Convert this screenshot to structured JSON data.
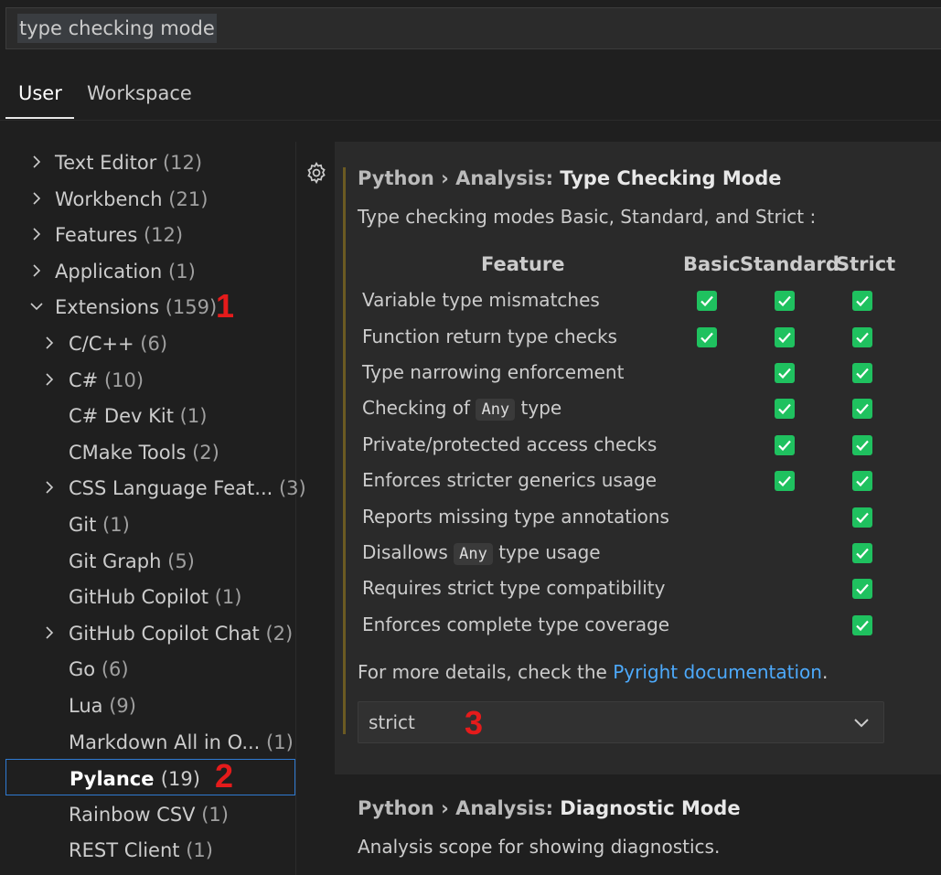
{
  "search": {
    "query": "type checking mode"
  },
  "tabs": [
    {
      "label": "User"
    },
    {
      "label": "Workspace"
    }
  ],
  "tree": [
    {
      "label": "Text Editor",
      "count": "(12)"
    },
    {
      "label": "Workbench",
      "count": "(21)"
    },
    {
      "label": "Features",
      "count": "(12)"
    },
    {
      "label": "Application",
      "count": "(1)"
    },
    {
      "label": "Extensions",
      "count": "(159)"
    },
    {
      "label": "C/C++",
      "count": "(6)"
    },
    {
      "label": "C#",
      "count": "(10)"
    },
    {
      "label": "C# Dev Kit",
      "count": "(1)"
    },
    {
      "label": "CMake Tools",
      "count": "(2)"
    },
    {
      "label": "CSS Language Feat...",
      "count": "(3)"
    },
    {
      "label": "Git",
      "count": "(1)"
    },
    {
      "label": "Git Graph",
      "count": "(5)"
    },
    {
      "label": "GitHub Copilot",
      "count": "(1)"
    },
    {
      "label": "GitHub Copilot Chat",
      "count": "(2)"
    },
    {
      "label": "Go",
      "count": "(6)"
    },
    {
      "label": "Lua",
      "count": "(9)"
    },
    {
      "label": "Markdown All in O...",
      "count": "(1)"
    },
    {
      "label": "Pylance",
      "count": "(19)"
    },
    {
      "label": "Rainbow CSV",
      "count": "(1)"
    },
    {
      "label": "REST Client",
      "count": "(1)"
    }
  ],
  "annotations": {
    "n1": "1",
    "n2": "2",
    "n3": "3"
  },
  "setting1": {
    "prefix": "Python › Analysis: ",
    "name": "Type Checking Mode",
    "description": "Type checking modes Basic, Standard, and Strict :",
    "table": {
      "headers": [
        "Feature",
        "Basic",
        "Standard",
        "Strict"
      ],
      "rows": [
        {
          "label": "Variable type mismatches",
          "basic": true,
          "standard": true,
          "strict": true
        },
        {
          "label": "Function return type checks",
          "basic": true,
          "standard": true,
          "strict": true
        },
        {
          "label": "Type narrowing enforcement",
          "basic": false,
          "standard": true,
          "strict": true
        },
        {
          "label_before": "Checking of",
          "code": "Any",
          "label_after": "type",
          "basic": false,
          "standard": true,
          "strict": true
        },
        {
          "label": "Private/protected access checks",
          "basic": false,
          "standard": true,
          "strict": true
        },
        {
          "label": "Enforces stricter generics usage",
          "basic": false,
          "standard": true,
          "strict": true
        },
        {
          "label": "Reports missing type annotations",
          "basic": false,
          "standard": false,
          "strict": true
        },
        {
          "label_before": "Disallows",
          "code": "Any",
          "label_after": "type usage",
          "basic": false,
          "standard": false,
          "strict": true
        },
        {
          "label": "Requires strict type compatibility",
          "basic": false,
          "standard": false,
          "strict": true
        },
        {
          "label": "Enforces complete type coverage",
          "basic": false,
          "standard": false,
          "strict": true
        }
      ]
    },
    "more_before": "For more details, check the ",
    "more_link": "Pyright documentation",
    "more_after": ".",
    "value": "strict"
  },
  "setting2": {
    "prefix": "Python › Analysis: ",
    "name": "Diagnostic Mode",
    "description": "Analysis scope for showing diagnostics."
  },
  "colors": {
    "accent": "#2f7ad1",
    "check": "#1fc15f",
    "link": "#4daafc",
    "annotation": "#e51b1b",
    "modified_bar": "#6b5a22"
  },
  "icons": {
    "gear": "gear-icon",
    "chevron_right": "chevron-right-icon",
    "chevron_down": "chevron-down-icon",
    "check": "checkbox-checked-icon"
  }
}
